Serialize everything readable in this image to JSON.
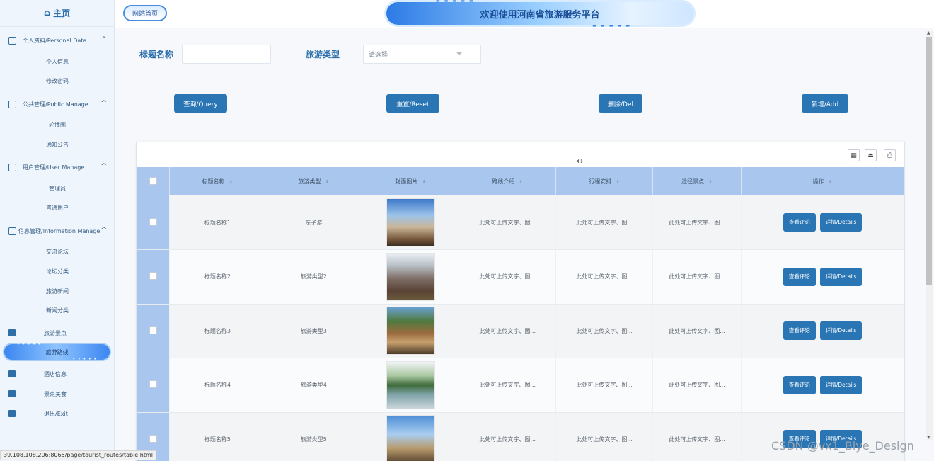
{
  "sidebar": {
    "home_label": "主页",
    "groups": [
      {
        "label": "个人资料/Personal Data",
        "items": [
          "个人信息",
          "修改密码"
        ]
      },
      {
        "label": "公共管理/Public Manage",
        "items": [
          "轮播图",
          "通知公告"
        ]
      },
      {
        "label": "用户管理/User Manage",
        "items": [
          "管理员",
          "普通用户"
        ]
      },
      {
        "label": "信息管理/Information Manage",
        "items": [
          "交流论坛",
          "论坛分类",
          "旅游新闻",
          "新闻分类"
        ]
      }
    ],
    "top_items": [
      "旅游景点",
      "旅游路线",
      "酒店信息",
      "景点美食",
      "退出/Exit"
    ],
    "active_item": "旅游路线"
  },
  "header": {
    "site_home": "网站首页",
    "banner_title": "欢迎使用河南省旅游服务平台"
  },
  "search": {
    "title_label": "标题名称",
    "title_value": "",
    "type_label": "旅游类型",
    "type_placeholder": "请选择"
  },
  "actions": {
    "query": "查询/Query",
    "reset": "重置/Reset",
    "delete": "删除/Del",
    "add": "新增/Add"
  },
  "table": {
    "columns": [
      "标题名称",
      "旅游类型",
      "封面图片",
      "路线介绍",
      "行程安排",
      "途径景点",
      "操作"
    ],
    "rows": [
      {
        "title": "标题名称1",
        "type": "亲子游",
        "intro": "此处可上传文字、图...",
        "schedule": "此处可上传文字、图...",
        "spots": "此处可上传文字、图..."
      },
      {
        "title": "标题名称2",
        "type": "旅游类型2",
        "intro": "此处可上传文字、图...",
        "schedule": "此处可上传文字、图...",
        "spots": "此处可上传文字、图..."
      },
      {
        "title": "标题名称3",
        "type": "旅游类型3",
        "intro": "此处可上传文字、图...",
        "schedule": "此处可上传文字、图...",
        "spots": "此处可上传文字、图..."
      },
      {
        "title": "标题名称4",
        "type": "旅游类型4",
        "intro": "此处可上传文字、图...",
        "schedule": "此处可上传文字、图...",
        "spots": "此处可上传文字、图..."
      },
      {
        "title": "标题名称5",
        "type": "旅游类型5",
        "intro": "此处可上传文字、图...",
        "schedule": "此处可上传文字、图...",
        "spots": "此处可上传文字、图..."
      }
    ],
    "row_actions": {
      "comments": "查看评论",
      "details": "详情/Details"
    }
  },
  "status_url": "39.108.108.206:8065/page/tourist_routes/table.html",
  "watermark": "CSDN @vx1_Biye_Design",
  "colors": {
    "accent": "#2a75b4",
    "header_row": "#a9c7ee",
    "sidebar_bg": "#eef5fc"
  }
}
